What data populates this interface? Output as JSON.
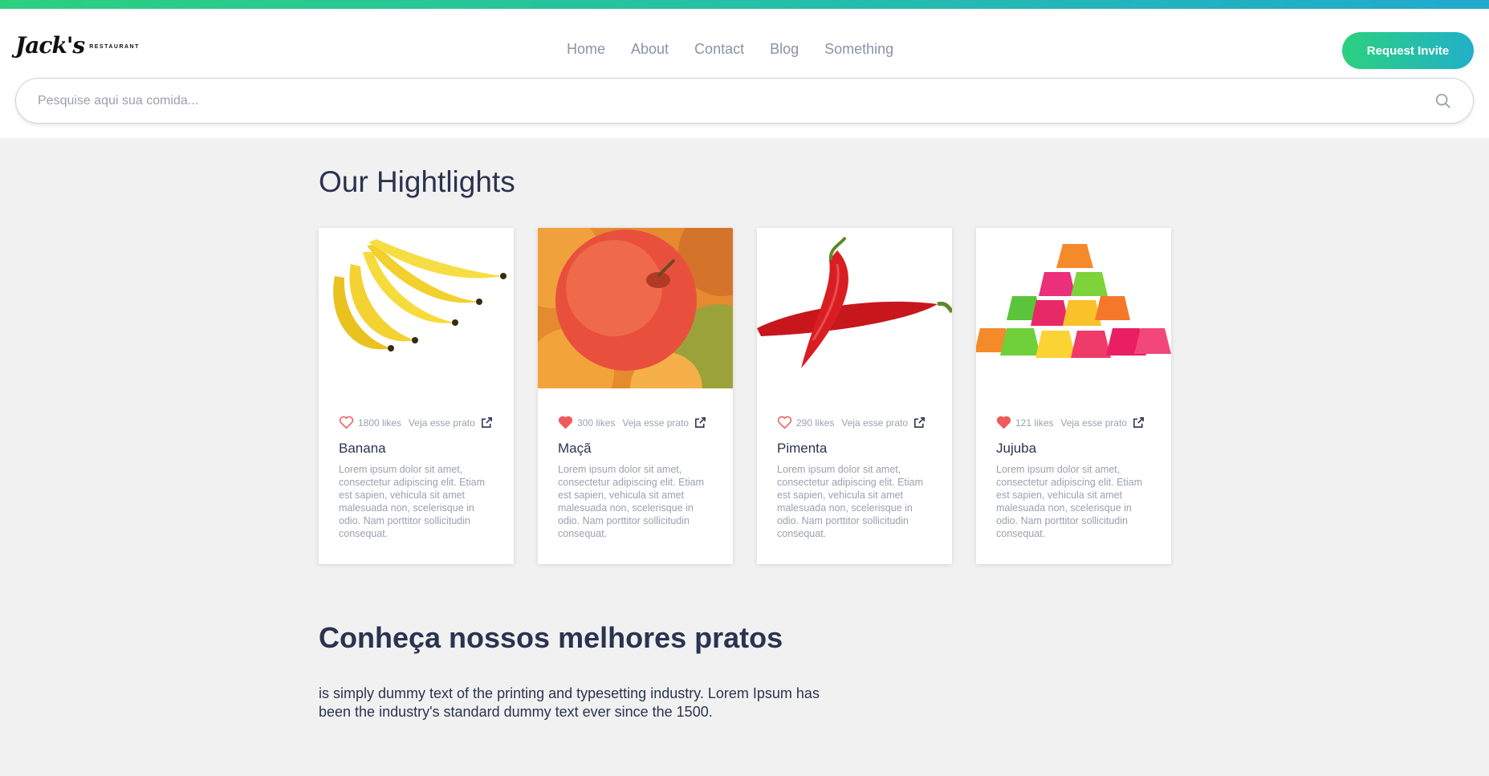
{
  "brand": {
    "name": "Jack's",
    "tagline": "RESTAURANT"
  },
  "nav": {
    "items": [
      "Home",
      "About",
      "Contact",
      "Blog",
      "Something"
    ],
    "cta_label": "Request Invite"
  },
  "search": {
    "placeholder": "Pesquise aqui sua comida...",
    "value": ""
  },
  "highlights": {
    "title": "Our Hightlights",
    "cards": [
      {
        "name": "Banana",
        "likes": "1800 likes",
        "liked": false,
        "link_label": "Veja esse prato",
        "description": "Lorem ipsum dolor sit amet, consectetur adipiscing elit. Etiam est sapien, vehicula sit amet malesuada non, scelerisque in odio. Nam porttitor sollicitudin consequat."
      },
      {
        "name": "Maçã",
        "likes": "300 likes",
        "liked": true,
        "link_label": "Veja esse prato",
        "description": "Lorem ipsum dolor sit amet, consectetur adipiscing elit. Etiam est sapien, vehicula sit amet malesuada non, scelerisque in odio. Nam porttitor sollicitudin consequat."
      },
      {
        "name": "Pimenta",
        "likes": "290 likes",
        "liked": false,
        "link_label": "Veja esse prato",
        "description": "Lorem ipsum dolor sit amet, consectetur adipiscing elit. Etiam est sapien, vehicula sit amet malesuada non, scelerisque in odio. Nam porttitor sollicitudin consequat."
      },
      {
        "name": "Jujuba",
        "likes": "121 likes",
        "liked": true,
        "link_label": "Veja esse prato",
        "description": "Lorem ipsum dolor sit amet, consectetur adipiscing elit. Etiam est sapien, vehicula sit amet malesuada non, scelerisque in odio. Nam porttitor sollicitudin consequat."
      }
    ]
  },
  "best_dishes": {
    "title": "Conheça nossos melhores pratos",
    "text": "is simply dummy text of the printing and typesetting industry. Lorem Ipsum has been the industry's standard dummy text ever since the 1500."
  },
  "colors": {
    "accent_start": "#2bd07f",
    "accent_end": "#21a9cf",
    "heart": "#f05a5a",
    "text_dark": "#2b3350",
    "text_muted": "#9aa1ad"
  },
  "icons": {
    "search": "search-icon",
    "like": "heart-icon",
    "open": "external-link-icon"
  }
}
